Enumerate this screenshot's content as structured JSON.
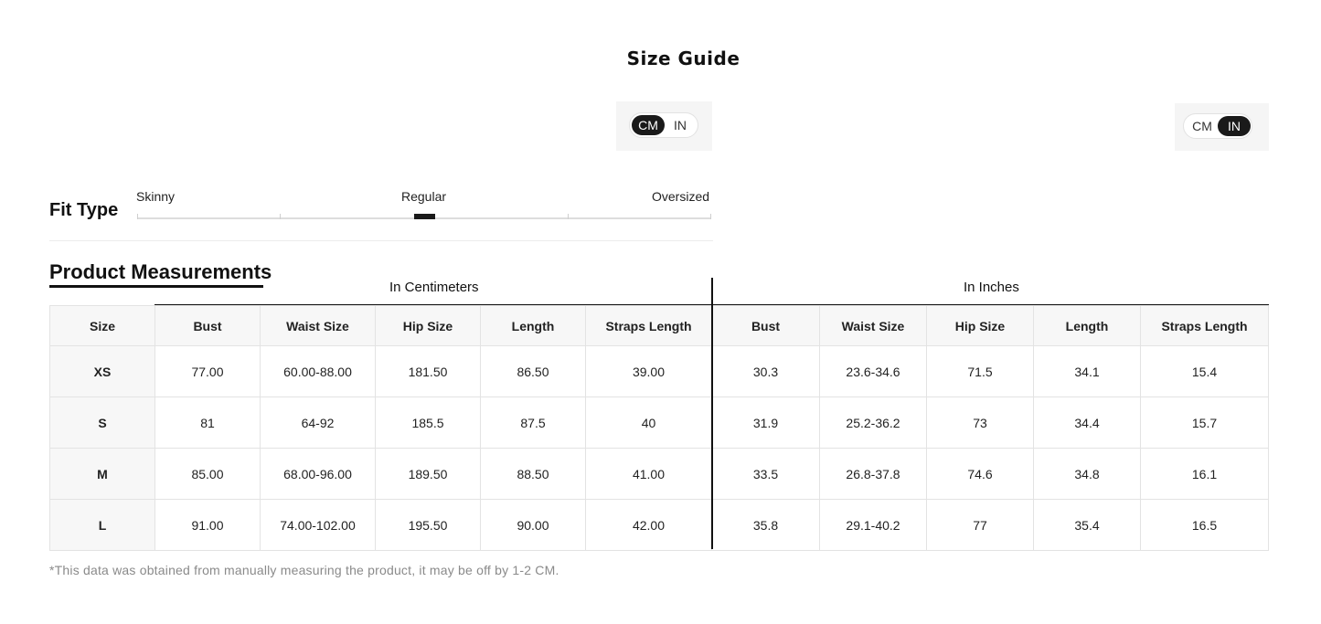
{
  "title": "Size Guide",
  "unit_toggle_left": {
    "options": [
      "CM",
      "IN"
    ],
    "selected": "CM"
  },
  "unit_toggle_right": {
    "options": [
      "CM",
      "IN"
    ],
    "selected": "IN"
  },
  "fit_type": {
    "label": "Fit Type",
    "ticks": [
      "Skinny",
      "Regular",
      "Oversized"
    ],
    "selected": "Regular"
  },
  "measurements": {
    "title": "Product Measurements",
    "group_cm": "In Centimeters",
    "group_in": "In Inches",
    "headers": [
      "Size",
      "Bust",
      "Waist Size",
      "Hip Size",
      "Length",
      "Straps Length",
      "Bust",
      "Waist Size",
      "Hip Size",
      "Length",
      "Straps Length"
    ],
    "rows": [
      [
        "XS",
        "77.00",
        "60.00-88.00",
        "181.50",
        "86.50",
        "39.00",
        "30.3",
        "23.6-34.6",
        "71.5",
        "34.1",
        "15.4"
      ],
      [
        "S",
        "81",
        "64-92",
        "185.5",
        "87.5",
        "40",
        "31.9",
        "25.2-36.2",
        "73",
        "34.4",
        "15.7"
      ],
      [
        "M",
        "85.00",
        "68.00-96.00",
        "189.50",
        "88.50",
        "41.00",
        "33.5",
        "26.8-37.8",
        "74.6",
        "34.8",
        "16.1"
      ],
      [
        "L",
        "91.00",
        "74.00-102.00",
        "195.50",
        "90.00",
        "42.00",
        "35.8",
        "29.1-40.2",
        "77",
        "35.4",
        "16.5"
      ]
    ]
  },
  "note": "*This data was obtained from manually measuring the product, it may be off by 1-2 CM."
}
